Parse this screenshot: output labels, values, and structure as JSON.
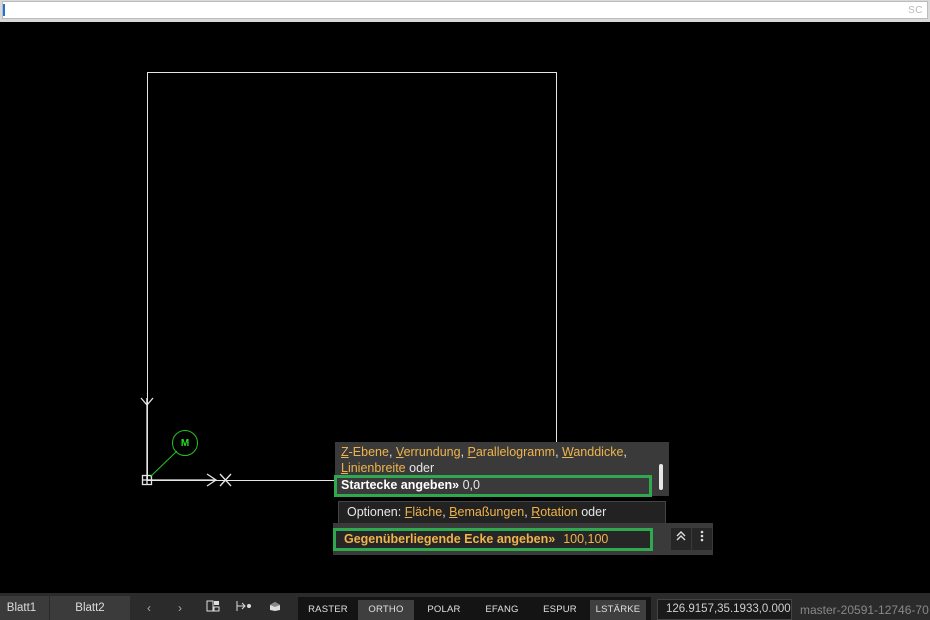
{
  "window": {
    "corner_text": "SC"
  },
  "command_history": {
    "options_line1": [
      {
        "underline": "Z",
        "rest": "-Ebene"
      },
      {
        "underline": "V",
        "rest": "errundung"
      },
      {
        "underline": "P",
        "rest": "arallelogramm"
      },
      {
        "underline": "W",
        "rest": "anddicke"
      }
    ],
    "separator": ", ",
    "options_line2": {
      "underline": "L",
      "rest": "inienbreite"
    },
    "oder": " oder",
    "prompt": "Startecke angeben»",
    "prompt_value": " 0,0"
  },
  "options_bar": {
    "prefix": "Optionen: ",
    "items": [
      {
        "underline": "F",
        "rest": "läche"
      },
      {
        "underline": "B",
        "rest": "emaßungen"
      },
      {
        "underline": "R",
        "rest": "otation"
      }
    ],
    "suffix": " oder"
  },
  "command_input": {
    "label": "Gegenüberliegende Ecke angeben»",
    "value": "100,100",
    "expand_icon": "double-chevron-up-icon",
    "more_icon": "vertical-ellipsis-icon"
  },
  "marker": {
    "label": "M"
  },
  "statusbar": {
    "tabs": [
      "Blatt1",
      "Blatt2"
    ],
    "nav_prev": "‹",
    "nav_next": "›",
    "toggles": [
      {
        "label": "RASTER",
        "active": false
      },
      {
        "label": "ORTHO",
        "active": true
      },
      {
        "label": "POLAR",
        "active": false
      },
      {
        "label": "EFANG",
        "active": false
      },
      {
        "label": "ESPUR",
        "active": false
      },
      {
        "label": "LSTÄRKE",
        "active": true
      }
    ],
    "coordinates": "126.9157,35.1933,0.0000",
    "version": "master-20591-12746-70"
  },
  "colors": {
    "canvas": "#000000",
    "highlight": "#2fa84f",
    "option_text": "#f0b44c",
    "marker": "#22c322"
  }
}
